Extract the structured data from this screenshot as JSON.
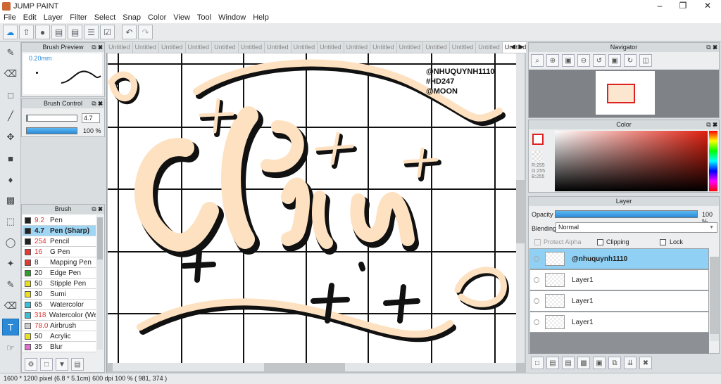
{
  "app": {
    "title": "JUMP PAINT"
  },
  "menu": [
    "File",
    "Edit",
    "Layer",
    "Filter",
    "Select",
    "Snap",
    "Color",
    "View",
    "Tool",
    "Window",
    "Help"
  ],
  "tabs": [
    "Untitled",
    "Untitled",
    "Untitled",
    "Untitled",
    "Untitled",
    "Untitled",
    "Untitled",
    "Untitled",
    "Untitled",
    "Untitled",
    "Untitled",
    "Untitled",
    "Untitled",
    "Untitled",
    "Untitled",
    "Untitled"
  ],
  "brush_preview": {
    "title": "Brush Preview",
    "size": "0.20mm"
  },
  "brush_control": {
    "title": "Brush Control",
    "size_value": "4.7",
    "opacity_value": "100 %"
  },
  "brush_list": {
    "title": "Brush",
    "items": [
      {
        "size": "9.2",
        "name": "Pen",
        "color": "#222222",
        "size_color": "#d33"
      },
      {
        "size": "4.7",
        "name": "Pen (Sharp)",
        "color": "#222222",
        "size_color": "#222",
        "selected": true
      },
      {
        "size": "254",
        "name": "Pencil",
        "color": "#222222",
        "size_color": "#d33"
      },
      {
        "size": "16",
        "name": "G Pen",
        "color": "#e53935",
        "size_color": "#d33"
      },
      {
        "size": "8",
        "name": "Mapping Pen",
        "color": "#e53935",
        "size_color": "#222"
      },
      {
        "size": "20",
        "name": "Edge Pen",
        "color": "#2e9e2e",
        "size_color": "#222"
      },
      {
        "size": "50",
        "name": "Stipple Pen",
        "color": "#e8e020",
        "size_color": "#222"
      },
      {
        "size": "30",
        "name": "Sumi",
        "color": "#e8e020",
        "size_color": "#222"
      },
      {
        "size": "65",
        "name": "Watercolor",
        "color": "#3cc0d8",
        "size_color": "#222"
      },
      {
        "size": "318",
        "name": "Watercolor (We",
        "color": "#3cc0d8",
        "size_color": "#d33"
      },
      {
        "size": "78.0",
        "name": "Airbrush",
        "color": "#cccccc",
        "size_color": "#d33"
      },
      {
        "size": "50",
        "name": "Acrylic",
        "color": "#e8e020",
        "size_color": "#222"
      },
      {
        "size": "35",
        "name": "Blur",
        "color": "#e070d0",
        "size_color": "#222"
      }
    ]
  },
  "canvas": {
    "watermark_lines": [
      "@NHUQUYNH1110",
      "#HD247",
      "@MOON"
    ],
    "art_text": "Chiu"
  },
  "status": {
    "text": "1600 * 1200 pixel   (6.8 * 5.1cm)   600 dpi   100 %   ( 981, 374 )"
  },
  "navigator": {
    "title": "Navigator"
  },
  "color_panel": {
    "title": "Color",
    "r": "R:255",
    "g": "G:255",
    "b": "B:255"
  },
  "layer_panel": {
    "title": "Layer",
    "opacity_label": "Opacity",
    "opacity_value": "100 %",
    "blending_label": "Blending",
    "blending_value": "Normal",
    "protect_alpha": "Protect Alpha",
    "clipping": "Clipping",
    "lock": "Lock",
    "layers": [
      {
        "name": "@nhuquynh1110",
        "selected": true
      },
      {
        "name": "Layer1"
      },
      {
        "name": "Layer1"
      },
      {
        "name": "Layer1"
      }
    ]
  }
}
